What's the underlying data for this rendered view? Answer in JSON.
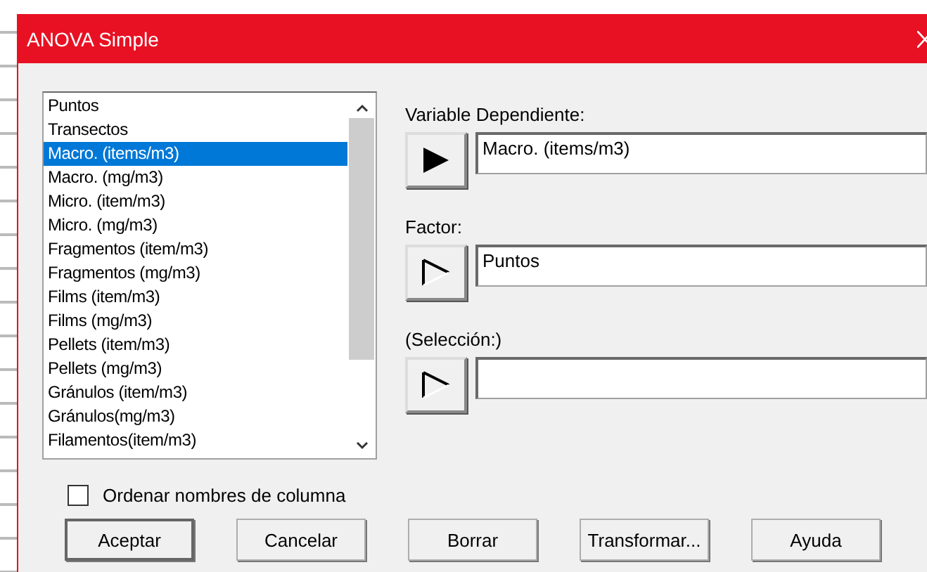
{
  "window": {
    "title": "ANOVA Simple"
  },
  "variables": {
    "items": [
      {
        "label": "Puntos",
        "selected": false
      },
      {
        "label": "Transectos",
        "selected": false
      },
      {
        "label": "Macro. (items/m3)",
        "selected": true
      },
      {
        "label": "Macro. (mg/m3)",
        "selected": false
      },
      {
        "label": "Micro. (item/m3)",
        "selected": false
      },
      {
        "label": "Micro. (mg/m3)",
        "selected": false
      },
      {
        "label": "Fragmentos (item/m3)",
        "selected": false
      },
      {
        "label": "Fragmentos (mg/m3)",
        "selected": false
      },
      {
        "label": "Films (item/m3)",
        "selected": false
      },
      {
        "label": "Films (mg/m3)",
        "selected": false
      },
      {
        "label": "Pellets (item/m3)",
        "selected": false
      },
      {
        "label": "Pellets (mg/m3)",
        "selected": false
      },
      {
        "label": "Gránulos (item/m3)",
        "selected": false
      },
      {
        "label": "Gránulos(mg/m3)",
        "selected": false
      },
      {
        "label": "Filamentos(item/m3)",
        "selected": false
      }
    ]
  },
  "slots": [
    {
      "label": "Variable Dependiente:",
      "value": "Macro. (items/m3)",
      "active": true
    },
    {
      "label": "Factor:",
      "value": "Puntos",
      "active": false
    },
    {
      "label": "(Selección:)",
      "active": false
    }
  ],
  "sort_columns": {
    "label": "Ordenar nombres de columna",
    "checked": false
  },
  "buttons": [
    {
      "label": "Aceptar",
      "default": true
    },
    {
      "label": "Cancelar",
      "default": false
    },
    {
      "label": "Borrar",
      "default": false
    },
    {
      "label": "Transformar...",
      "default": false
    },
    {
      "label": "Ayuda",
      "default": false
    }
  ]
}
